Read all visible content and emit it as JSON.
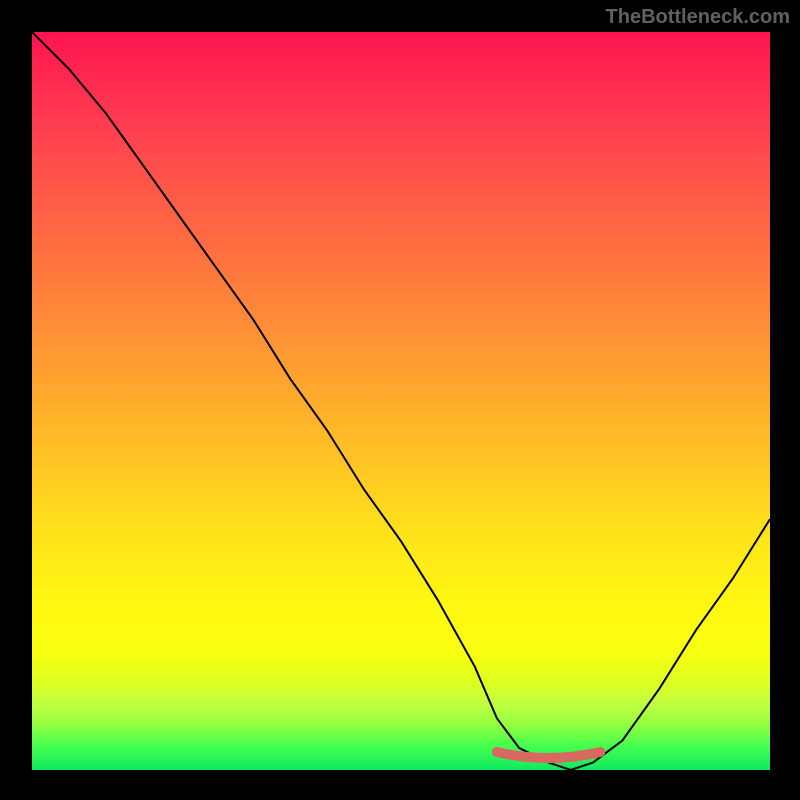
{
  "watermark": "TheBottleneck.com",
  "chart_data": {
    "type": "line",
    "title": "",
    "xlabel": "",
    "ylabel": "",
    "x": [
      0,
      5,
      10,
      15,
      20,
      25,
      30,
      35,
      40,
      45,
      50,
      55,
      60,
      63,
      66,
      70,
      73,
      76,
      80,
      85,
      90,
      95,
      100
    ],
    "values": [
      100,
      95,
      89,
      82,
      75,
      68,
      61,
      53,
      46,
      38,
      31,
      23,
      14,
      7,
      3,
      1,
      0,
      1,
      4,
      11,
      19,
      26,
      34
    ],
    "xlim": [
      0,
      100
    ],
    "ylim": [
      0,
      100
    ],
    "background": "rainbow-gradient",
    "optimal_marker": {
      "x_start": 63,
      "x_end": 77,
      "color": "#d86860"
    }
  }
}
